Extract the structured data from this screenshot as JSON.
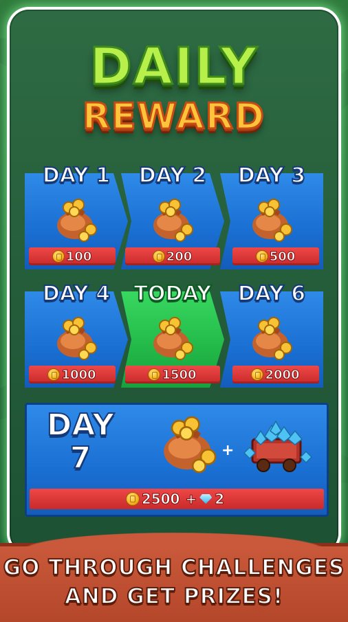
{
  "title": {
    "line1": "DAILY",
    "line2": "REWARD"
  },
  "days": [
    {
      "label": "DAY 1",
      "amount": "100",
      "state": "claimed"
    },
    {
      "label": "DAY 2",
      "amount": "200",
      "state": "claimed"
    },
    {
      "label": "DAY 3",
      "amount": "500",
      "state": "claimed"
    },
    {
      "label": "DAY 4",
      "amount": "1000",
      "state": "claimed"
    },
    {
      "label": "TODAY",
      "amount": "1500",
      "state": "today"
    },
    {
      "label": "DAY 6",
      "amount": "2000",
      "state": "locked"
    }
  ],
  "day7": {
    "label_line1": "DAY",
    "label_line2": "7",
    "coins": "2500",
    "plus": "+",
    "gems": "2"
  },
  "banner": {
    "line1": "GO THROUGH CHALLENGES",
    "line2": "AND GET PRIZES!"
  },
  "colors": {
    "card_blue": "#1a6fd2",
    "card_today": "#22b848",
    "amount_bar": "#d83636",
    "title_green": "#b7f04b",
    "title_orange": "#ffc43a"
  }
}
